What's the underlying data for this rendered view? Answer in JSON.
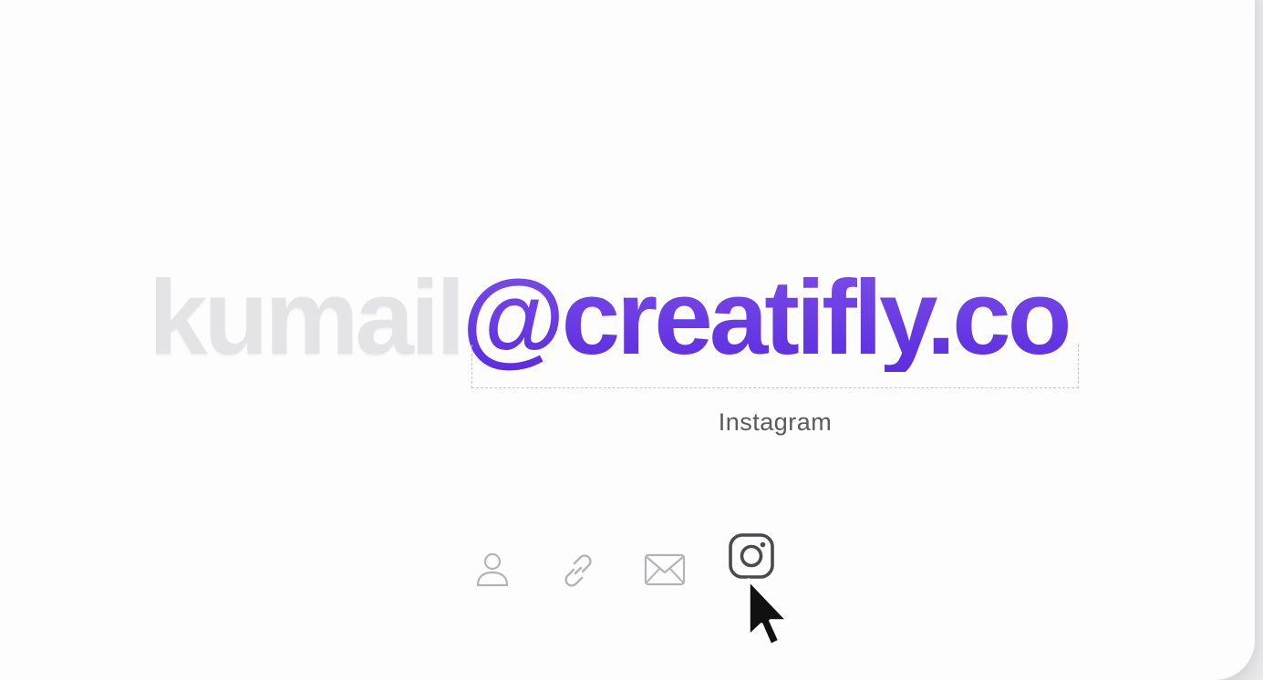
{
  "headline": {
    "prefix": "kumail",
    "accent": "@creatifly.co"
  },
  "tooltip": {
    "label": "Instagram"
  },
  "icons": [
    {
      "name": "person-icon",
      "state": "inactive"
    },
    {
      "name": "link-icon",
      "state": "inactive"
    },
    {
      "name": "mail-icon",
      "state": "inactive"
    },
    {
      "name": "instagram-icon",
      "state": "active"
    }
  ],
  "colors": {
    "accent_top": "#7b4de8",
    "accent_bottom": "#5b2de0",
    "ghost_text": "#e4e4e6",
    "icon_inactive": "#b4b4b8",
    "icon_active": "#4a4a4e",
    "card_bg": "#fdfdfd"
  }
}
